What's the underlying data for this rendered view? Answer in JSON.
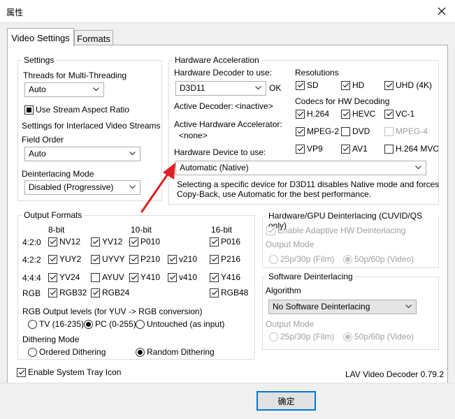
{
  "window": {
    "title": "属性"
  },
  "tabs": [
    {
      "label": "Video Settings"
    },
    {
      "label": "Formats"
    }
  ],
  "settings": {
    "title": "Settings",
    "threads_label": "Threads for Multi-Threading",
    "threads_value": "Auto",
    "stream_aspect_label": "Use Stream Aspect Ratio",
    "interlaced_label": "Settings for Interlaced Video Streams",
    "field_order_label": "Field Order",
    "field_order_value": "Auto",
    "deint_mode_label": "Deinterlacing Mode",
    "deint_mode_value": "Disabled (Progressive)"
  },
  "hwaccel": {
    "title": "Hardware Acceleration",
    "decoder_label": "Hardware Decoder to use:",
    "decoder_value": "D3D11",
    "decoder_status": "OK",
    "active_decoder_label": "Active Decoder:",
    "active_decoder_value": "<inactive>",
    "active_accel_label": "Active Hardware Accelerator:",
    "active_accel_value": "<none>",
    "device_label": "Hardware Device to use:",
    "device_value": "Automatic (Native)",
    "note_line1": "Selecting a specific device for D3D11 disables Native mode and forces",
    "note_line2": "Copy-Back, use Automatic for the best performance.",
    "resolutions_label": "Resolutions",
    "resolutions": [
      {
        "label": "SD"
      },
      {
        "label": "HD"
      },
      {
        "label": "UHD (4K)"
      }
    ],
    "codecs_label": "Codecs for HW Decoding",
    "codecs": [
      {
        "label": "H.264"
      },
      {
        "label": "HEVC"
      },
      {
        "label": "VC-1"
      },
      {
        "label": "MPEG-2"
      },
      {
        "label": "DVD"
      },
      {
        "label": "MPEG-4"
      },
      {
        "label": "VP9"
      },
      {
        "label": "AV1"
      },
      {
        "label": "H.264 MVC"
      }
    ]
  },
  "output": {
    "title": "Output Formats",
    "col_8bit": "8-bit",
    "col_10bit": "10-bit",
    "col_16bit": "16-bit",
    "row_420": "4:2:0",
    "row_422": "4:2:2",
    "row_444": "4:4:4",
    "row_rgb": "RGB",
    "f": {
      "nv12": "NV12",
      "yv12": "YV12",
      "p010": "P010",
      "p016": "P016",
      "yuy2": "YUY2",
      "uyvy": "UYVY",
      "p210": "P210",
      "v210": "v210",
      "p216": "P216",
      "yv24": "YV24",
      "ayuv": "AYUV",
      "y410": "Y410",
      "v410": "v410",
      "y416": "Y416",
      "rgb32": "RGB32",
      "rgb24": "RGB24",
      "rgb48": "RGB48"
    },
    "levels_label": "RGB Output levels (for YUV -> RGB conversion)",
    "levels": [
      {
        "label": "TV (16-235)"
      },
      {
        "label": "PC (0-255)"
      },
      {
        "label": "Untouched (as input)"
      }
    ],
    "dither_label": "Dithering Mode",
    "dither": [
      {
        "label": "Ordered Dithering"
      },
      {
        "label": "Random Dithering"
      }
    ]
  },
  "hwdeint": {
    "title": "Hardware/GPU Deinterlacing (CUVID/QS only)",
    "adaptive_label": "Enable Adaptive HW Deinterlacing",
    "output_mode_label": "Output Mode",
    "modes": [
      {
        "label": "25p/30p (Film)"
      },
      {
        "label": "50p/60p (Video)"
      }
    ]
  },
  "swdeint": {
    "title": "Software Deinterlacing",
    "algorithm_label": "Algorithm",
    "algorithm_value": "No Software Deinterlacing",
    "output_mode_label": "Output Mode",
    "modes": [
      {
        "label": "25p/30p (Film)"
      },
      {
        "label": "50p/60p (Video)"
      }
    ]
  },
  "systray_label": "Enable System Tray Icon",
  "version": "LAV Video Decoder 0.79.2",
  "ok_button": "确定",
  "colors": {
    "accent": "#0078d7",
    "arrow": "#e02020"
  },
  "icons": {
    "close": "close-icon",
    "dropdown": "chevron-down-icon"
  }
}
